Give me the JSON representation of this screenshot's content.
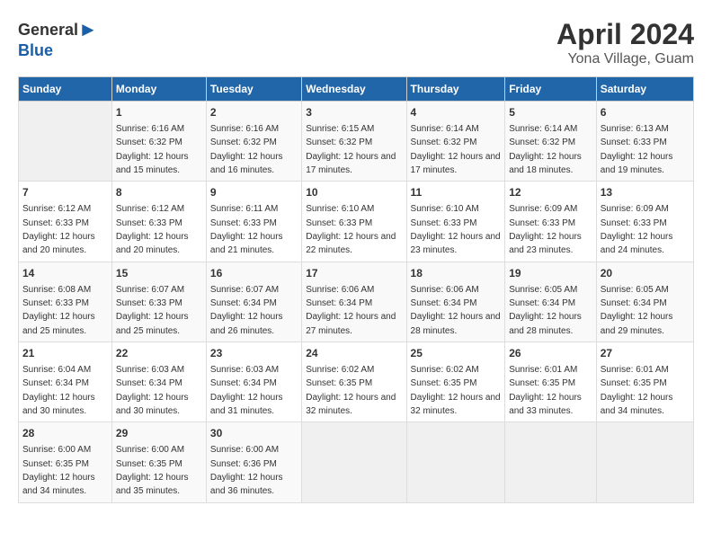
{
  "header": {
    "logo_general": "General",
    "logo_blue": "Blue",
    "title": "April 2024",
    "subtitle": "Yona Village, Guam"
  },
  "days_of_week": [
    "Sunday",
    "Monday",
    "Tuesday",
    "Wednesday",
    "Thursday",
    "Friday",
    "Saturday"
  ],
  "weeks": [
    [
      {
        "day": "",
        "sunrise": "",
        "sunset": "",
        "daylight": "",
        "empty": true
      },
      {
        "day": "1",
        "sunrise": "Sunrise: 6:16 AM",
        "sunset": "Sunset: 6:32 PM",
        "daylight": "Daylight: 12 hours and 15 minutes."
      },
      {
        "day": "2",
        "sunrise": "Sunrise: 6:16 AM",
        "sunset": "Sunset: 6:32 PM",
        "daylight": "Daylight: 12 hours and 16 minutes."
      },
      {
        "day": "3",
        "sunrise": "Sunrise: 6:15 AM",
        "sunset": "Sunset: 6:32 PM",
        "daylight": "Daylight: 12 hours and 17 minutes."
      },
      {
        "day": "4",
        "sunrise": "Sunrise: 6:14 AM",
        "sunset": "Sunset: 6:32 PM",
        "daylight": "Daylight: 12 hours and 17 minutes."
      },
      {
        "day": "5",
        "sunrise": "Sunrise: 6:14 AM",
        "sunset": "Sunset: 6:32 PM",
        "daylight": "Daylight: 12 hours and 18 minutes."
      },
      {
        "day": "6",
        "sunrise": "Sunrise: 6:13 AM",
        "sunset": "Sunset: 6:33 PM",
        "daylight": "Daylight: 12 hours and 19 minutes."
      }
    ],
    [
      {
        "day": "7",
        "sunrise": "Sunrise: 6:12 AM",
        "sunset": "Sunset: 6:33 PM",
        "daylight": "Daylight: 12 hours and 20 minutes."
      },
      {
        "day": "8",
        "sunrise": "Sunrise: 6:12 AM",
        "sunset": "Sunset: 6:33 PM",
        "daylight": "Daylight: 12 hours and 20 minutes."
      },
      {
        "day": "9",
        "sunrise": "Sunrise: 6:11 AM",
        "sunset": "Sunset: 6:33 PM",
        "daylight": "Daylight: 12 hours and 21 minutes."
      },
      {
        "day": "10",
        "sunrise": "Sunrise: 6:10 AM",
        "sunset": "Sunset: 6:33 PM",
        "daylight": "Daylight: 12 hours and 22 minutes."
      },
      {
        "day": "11",
        "sunrise": "Sunrise: 6:10 AM",
        "sunset": "Sunset: 6:33 PM",
        "daylight": "Daylight: 12 hours and 23 minutes."
      },
      {
        "day": "12",
        "sunrise": "Sunrise: 6:09 AM",
        "sunset": "Sunset: 6:33 PM",
        "daylight": "Daylight: 12 hours and 23 minutes."
      },
      {
        "day": "13",
        "sunrise": "Sunrise: 6:09 AM",
        "sunset": "Sunset: 6:33 PM",
        "daylight": "Daylight: 12 hours and 24 minutes."
      }
    ],
    [
      {
        "day": "14",
        "sunrise": "Sunrise: 6:08 AM",
        "sunset": "Sunset: 6:33 PM",
        "daylight": "Daylight: 12 hours and 25 minutes."
      },
      {
        "day": "15",
        "sunrise": "Sunrise: 6:07 AM",
        "sunset": "Sunset: 6:33 PM",
        "daylight": "Daylight: 12 hours and 25 minutes."
      },
      {
        "day": "16",
        "sunrise": "Sunrise: 6:07 AM",
        "sunset": "Sunset: 6:34 PM",
        "daylight": "Daylight: 12 hours and 26 minutes."
      },
      {
        "day": "17",
        "sunrise": "Sunrise: 6:06 AM",
        "sunset": "Sunset: 6:34 PM",
        "daylight": "Daylight: 12 hours and 27 minutes."
      },
      {
        "day": "18",
        "sunrise": "Sunrise: 6:06 AM",
        "sunset": "Sunset: 6:34 PM",
        "daylight": "Daylight: 12 hours and 28 minutes."
      },
      {
        "day": "19",
        "sunrise": "Sunrise: 6:05 AM",
        "sunset": "Sunset: 6:34 PM",
        "daylight": "Daylight: 12 hours and 28 minutes."
      },
      {
        "day": "20",
        "sunrise": "Sunrise: 6:05 AM",
        "sunset": "Sunset: 6:34 PM",
        "daylight": "Daylight: 12 hours and 29 minutes."
      }
    ],
    [
      {
        "day": "21",
        "sunrise": "Sunrise: 6:04 AM",
        "sunset": "Sunset: 6:34 PM",
        "daylight": "Daylight: 12 hours and 30 minutes."
      },
      {
        "day": "22",
        "sunrise": "Sunrise: 6:03 AM",
        "sunset": "Sunset: 6:34 PM",
        "daylight": "Daylight: 12 hours and 30 minutes."
      },
      {
        "day": "23",
        "sunrise": "Sunrise: 6:03 AM",
        "sunset": "Sunset: 6:34 PM",
        "daylight": "Daylight: 12 hours and 31 minutes."
      },
      {
        "day": "24",
        "sunrise": "Sunrise: 6:02 AM",
        "sunset": "Sunset: 6:35 PM",
        "daylight": "Daylight: 12 hours and 32 minutes."
      },
      {
        "day": "25",
        "sunrise": "Sunrise: 6:02 AM",
        "sunset": "Sunset: 6:35 PM",
        "daylight": "Daylight: 12 hours and 32 minutes."
      },
      {
        "day": "26",
        "sunrise": "Sunrise: 6:01 AM",
        "sunset": "Sunset: 6:35 PM",
        "daylight": "Daylight: 12 hours and 33 minutes."
      },
      {
        "day": "27",
        "sunrise": "Sunrise: 6:01 AM",
        "sunset": "Sunset: 6:35 PM",
        "daylight": "Daylight: 12 hours and 34 minutes."
      }
    ],
    [
      {
        "day": "28",
        "sunrise": "Sunrise: 6:00 AM",
        "sunset": "Sunset: 6:35 PM",
        "daylight": "Daylight: 12 hours and 34 minutes."
      },
      {
        "day": "29",
        "sunrise": "Sunrise: 6:00 AM",
        "sunset": "Sunset: 6:35 PM",
        "daylight": "Daylight: 12 hours and 35 minutes."
      },
      {
        "day": "30",
        "sunrise": "Sunrise: 6:00 AM",
        "sunset": "Sunset: 6:36 PM",
        "daylight": "Daylight: 12 hours and 36 minutes."
      },
      {
        "day": "",
        "sunrise": "",
        "sunset": "",
        "daylight": "",
        "empty": true
      },
      {
        "day": "",
        "sunrise": "",
        "sunset": "",
        "daylight": "",
        "empty": true
      },
      {
        "day": "",
        "sunrise": "",
        "sunset": "",
        "daylight": "",
        "empty": true
      },
      {
        "day": "",
        "sunrise": "",
        "sunset": "",
        "daylight": "",
        "empty": true
      }
    ]
  ]
}
